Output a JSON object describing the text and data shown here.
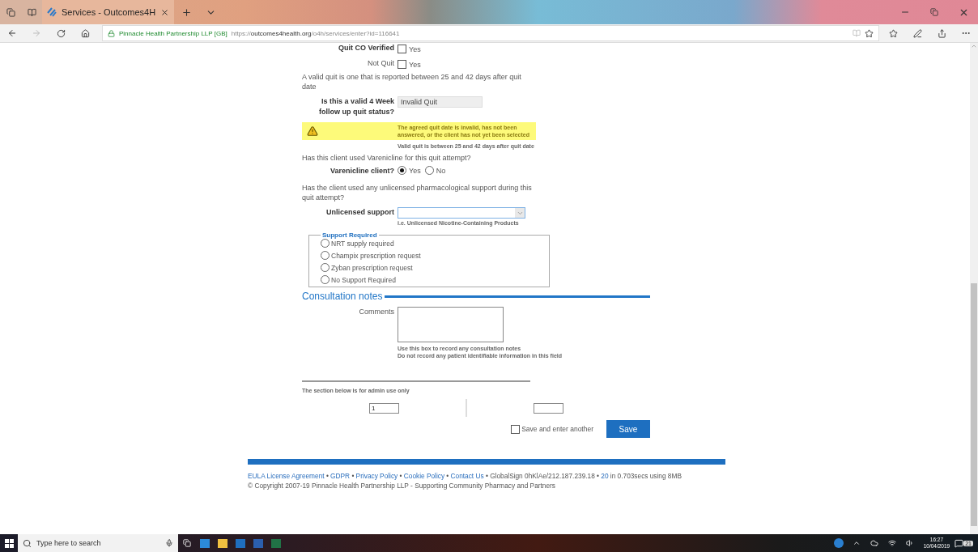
{
  "browser": {
    "tab_title": "Services - Outcomes4H",
    "site_identity": "Pinnacle Health Partnership LLP [GB]",
    "url_scheme": "https://",
    "url_host": "outcomes4health.org",
    "url_path": "/o4h/services/enter?id=116641"
  },
  "form": {
    "checkbox_rows": [
      {
        "label": "Quit CO Verified",
        "option": "Yes",
        "checked": false
      },
      {
        "label": "Not Quit",
        "option": "Yes",
        "checked": false
      }
    ],
    "valid_note": "A valid quit is one that is reported between 25 and 42 days after quit date",
    "status_label": "Is this a valid 4 Week follow up quit status?",
    "status_value": "Invalid Quit",
    "warning": "The agreed quit date is invalid, has not been answered, or the client has not yet been selected",
    "warning_hint": "Valid quit is between 25 and 42 days after quit date",
    "varenicline_question": "Has this client used Varenicline for this quit attempt?",
    "varenicline_label": "Varenicline client?",
    "varenicline_options": [
      {
        "label": "Yes",
        "selected": true
      },
      {
        "label": "No",
        "selected": false
      }
    ],
    "unlicensed_question": "Has the client used any unlicensed pharmacological support during this quit attempt?",
    "unlicensed_label": "Unlicensed support",
    "unlicensed_hint": "i.e. Unlicensed Nicotine-Containing Products",
    "support_legend": "Support Required",
    "support_options": [
      {
        "label": "NRT supply required",
        "selected": false
      },
      {
        "label": "Champix prescription request",
        "selected": false
      },
      {
        "label": "Zyban prescription request",
        "selected": false
      },
      {
        "label": "No Support Required",
        "selected": false
      }
    ],
    "consultation_heading": "Consultation notes",
    "comments_label": "Comments",
    "comments_hints": [
      "Use this box to record any consultation notes",
      "Do not record any patient identifiable information in this field"
    ],
    "admin_note": "The section below is for admin use only",
    "admin_value": "1",
    "save_another": {
      "label": "Save and enter another",
      "checked": false
    },
    "save_button": "Save"
  },
  "footer": {
    "items": [
      {
        "kind": "link",
        "text": "EULA License Agreement"
      },
      {
        "kind": "text",
        "text": "•"
      },
      {
        "kind": "link",
        "text": "GDPR"
      },
      {
        "kind": "text",
        "text": "•"
      },
      {
        "kind": "link",
        "text": "Privacy Policy"
      },
      {
        "kind": "text",
        "text": "•"
      },
      {
        "kind": "link",
        "text": "Cookie Policy"
      },
      {
        "kind": "text",
        "text": "•"
      },
      {
        "kind": "link",
        "text": "Contact Us"
      },
      {
        "kind": "text",
        "text": "• GlobalSign 0hKlAe/212.187.239.18 •"
      },
      {
        "kind": "link",
        "text": "20"
      },
      {
        "kind": "text",
        "text": "in 0.703secs using 8MB"
      }
    ],
    "copyright": "© Copyright 2007-19 Pinnacle Health Partnership LLP - Supporting Community Pharmacy and Partners"
  },
  "taskbar": {
    "search_placeholder": "Type here to search",
    "time": "16:27",
    "date": "10/04/2019",
    "notifications": "21"
  }
}
